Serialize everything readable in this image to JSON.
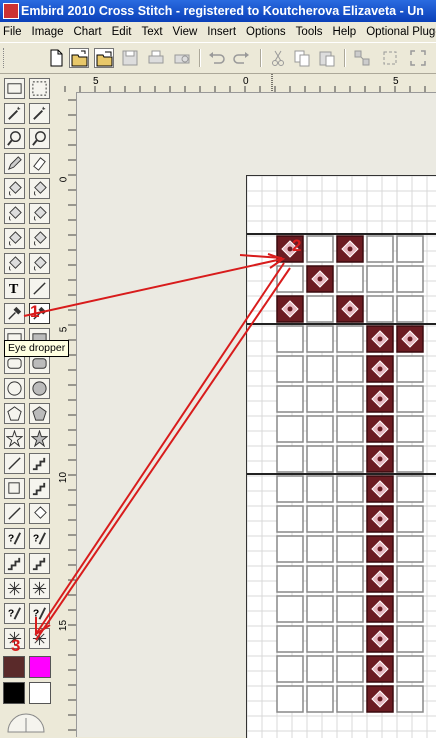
{
  "window": {
    "title": "Embird 2010 Cross Stitch - registered to Koutcherova Elizaveta - Un"
  },
  "menu": [
    "File",
    "Image",
    "Chart",
    "Edit",
    "Text",
    "View",
    "Insert",
    "Options",
    "Tools",
    "Help",
    "Optional Plug-"
  ],
  "rulers": {
    "top_labels": [
      "5",
      "0",
      "5"
    ],
    "left_labels": [
      "0",
      "5",
      "10",
      "15"
    ]
  },
  "tooltip": "Eye dropper",
  "annotations": [
    "1",
    "2",
    "3"
  ],
  "colors": {
    "foreground": "#5a2a2a",
    "background": "#ff00ff",
    "black": "#000000",
    "white": "#ffffff",
    "stitch": "#6b1c22",
    "arrow": "#d81c1c"
  },
  "tools": [
    "rect-select-icon",
    "lasso-select-icon",
    "magic-wand-icon",
    "magic-wand-plus-icon",
    "zoom-1-icon",
    "zoom-icon",
    "pencil-icon",
    "eraser-icon",
    "fill-icon",
    "no-fill-icon",
    "spray-icon",
    "brush-icon",
    "bucket-icon",
    "bucket-alt-icon",
    "bucket-2-icon",
    "bucket-3-icon",
    "text-icon",
    "line-icon",
    "eye-dropper-icon",
    "bold-eye-dropper-icon",
    "rectangle-icon",
    "filled-rectangle-icon",
    "rounded-rect-icon",
    "filled-rounded-rect-icon",
    "ellipse-icon",
    "filled-ellipse-icon",
    "polygon-icon",
    "filled-polygon-icon",
    "star-icon",
    "filled-star-icon",
    "backstitch-line-icon",
    "stair-icon",
    "backstitch-line-2-icon",
    "stair-2-icon",
    "knot-line-icon",
    "bead-icon",
    "question-line-icon",
    "question-line-2-icon",
    "question-stair-icon",
    "question-stair-2-icon",
    "star-burst-icon",
    "star-burst-2-icon",
    "question-knot-icon",
    "question-knot-2-icon",
    "question-burst-icon",
    "question-burst-2-icon"
  ]
}
